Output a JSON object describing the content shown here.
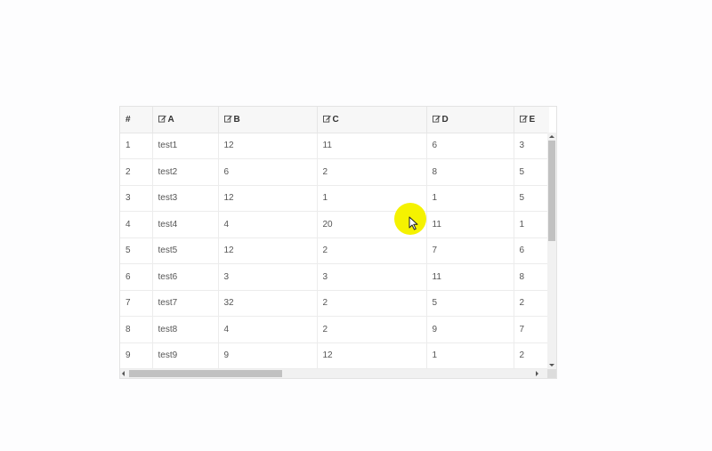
{
  "table": {
    "columns": [
      "#",
      "A",
      "B",
      "C",
      "D",
      "E"
    ],
    "rows": [
      [
        "1",
        "test1",
        "12",
        "11",
        "6",
        "3"
      ],
      [
        "2",
        "test2",
        "6",
        "2",
        "8",
        "5"
      ],
      [
        "3",
        "test3",
        "12",
        "1",
        "1",
        "5"
      ],
      [
        "4",
        "test4",
        "4",
        "20",
        "11",
        "1"
      ],
      [
        "5",
        "test5",
        "12",
        "2",
        "7",
        "6"
      ],
      [
        "6",
        "test6",
        "3",
        "3",
        "11",
        "8"
      ],
      [
        "7",
        "test7",
        "32",
        "2",
        "5",
        "2"
      ],
      [
        "8",
        "test8",
        "4",
        "2",
        "9",
        "7"
      ],
      [
        "9",
        "test9",
        "9",
        "12",
        "1",
        "2"
      ]
    ]
  },
  "icons": {
    "editable_column": "edit-icon"
  },
  "colors": {
    "cursor_highlight": "#f5f200",
    "header_background": "#f7f7f7"
  }
}
